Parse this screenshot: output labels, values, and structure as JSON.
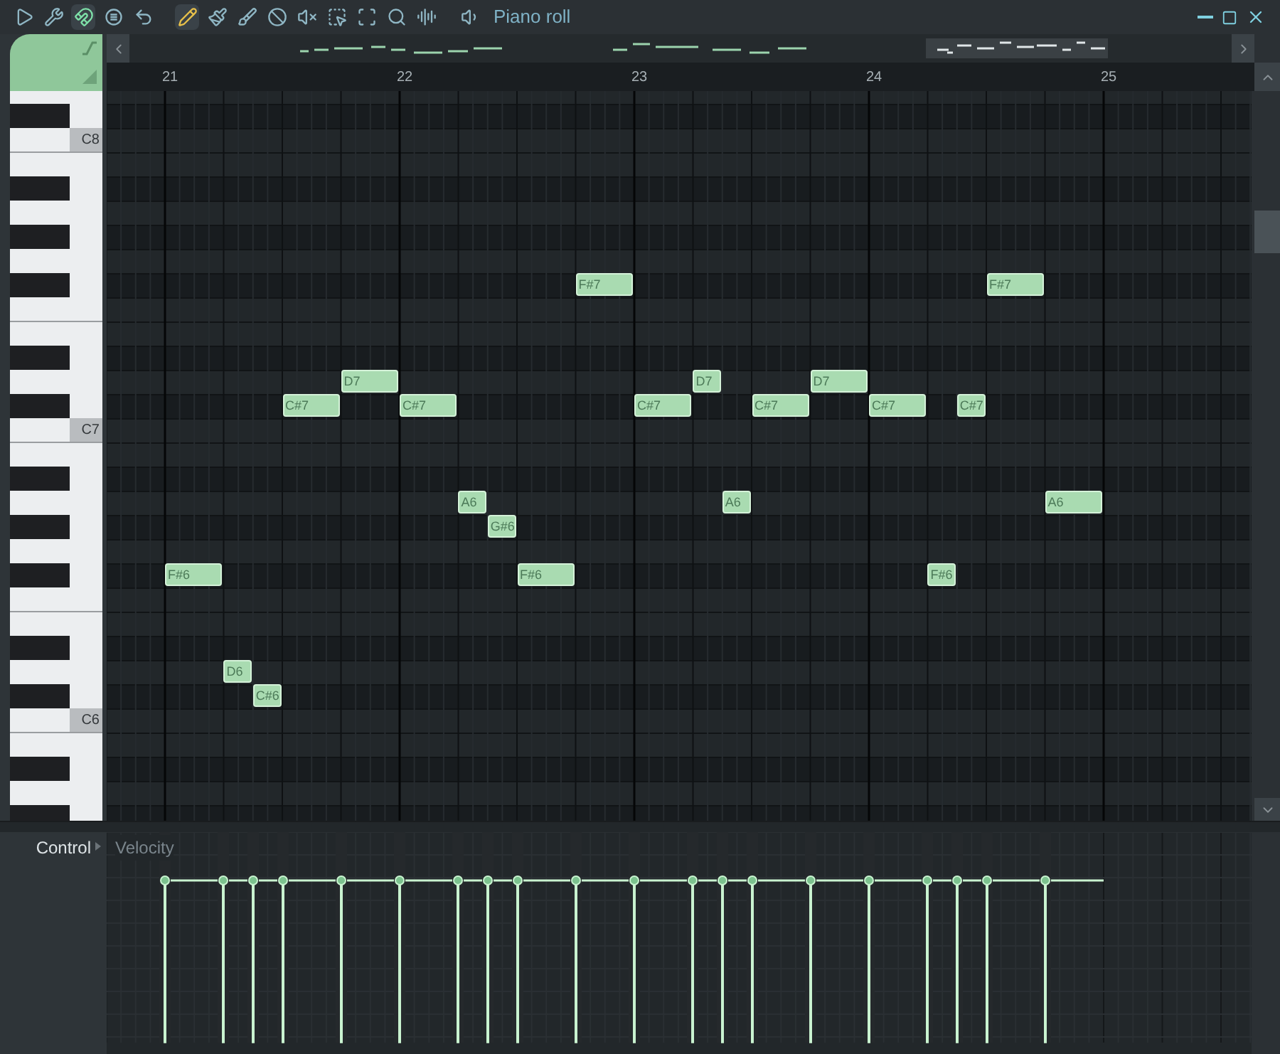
{
  "window": {
    "title": "Piano roll"
  },
  "tools": [
    {
      "kind": "play",
      "selected": false
    },
    {
      "kind": "wrench",
      "selected": false
    },
    {
      "kind": "magnet",
      "selected": true
    },
    {
      "kind": "menu",
      "selected": false
    },
    {
      "kind": "undo",
      "selected": false
    },
    {
      "kind": "pencil",
      "selected": true
    },
    {
      "kind": "brush",
      "selected": false
    },
    {
      "kind": "slice",
      "selected": false
    },
    {
      "kind": "delete",
      "selected": false
    },
    {
      "kind": "mute",
      "selected": false
    },
    {
      "kind": "select",
      "selected": false
    },
    {
      "kind": "zoom-fit",
      "selected": false
    },
    {
      "kind": "zoom",
      "selected": false
    },
    {
      "kind": "playback",
      "selected": false
    },
    {
      "kind": "speaker",
      "selected": false
    }
  ],
  "timeline": [
    "21",
    "22",
    "23",
    "24",
    "25"
  ],
  "keyboard": {
    "labels": [
      "C8",
      "C7",
      "C6"
    ]
  },
  "notes": [
    {
      "label": "F#6",
      "level": 0.8
    },
    {
      "label": "D6",
      "level": 0.8
    },
    {
      "label": "C#6",
      "level": 0.8
    },
    {
      "label": "C#7",
      "level": 0.8
    },
    {
      "label": "D7",
      "level": 0.8
    },
    {
      "label": "C#7",
      "level": 0.8
    },
    {
      "label": "A6",
      "level": 0.8
    },
    {
      "label": "G#6",
      "level": 0.8
    },
    {
      "label": "F#6",
      "level": 0.8
    },
    {
      "label": "F#7",
      "level": 0.8
    },
    {
      "label": "C#7",
      "level": 0.8
    },
    {
      "label": "D7",
      "level": 0.8
    },
    {
      "label": "A6",
      "level": 0.8
    },
    {
      "label": "C#7",
      "level": 0.8
    },
    {
      "label": "D7",
      "level": 0.8
    },
    {
      "label": "C#7",
      "level": 0.8
    },
    {
      "label": "F#6",
      "level": 0.8
    },
    {
      "label": "C#7",
      "level": 0.8
    },
    {
      "label": "F#7",
      "level": 0.8
    },
    {
      "label": "A6",
      "level": 0.8
    }
  ],
  "control": {
    "label": "Control",
    "parameter": "Velocity"
  }
}
